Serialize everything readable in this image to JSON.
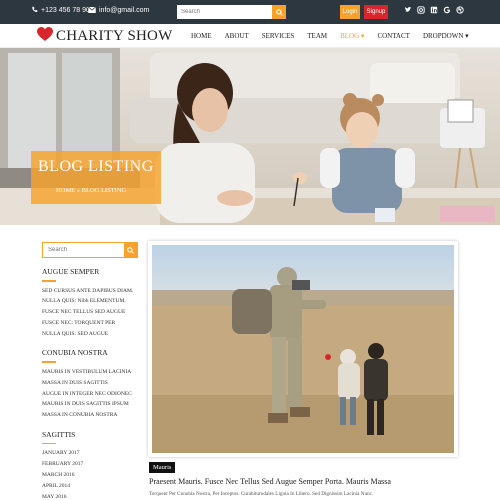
{
  "topbar": {
    "phone": "+123 456 78 90",
    "email": "info@gmail.com",
    "search_placeholder": "Search",
    "login_label": "Login",
    "signup_label": "Signup",
    "social_icons": [
      "twitter-icon",
      "instagram-icon",
      "linkedin-icon",
      "google-icon",
      "dribbble-icon"
    ],
    "bg_color": "#2d3740",
    "accent_color": "#f7a22c",
    "signup_color": "#d9262c"
  },
  "header": {
    "logo_text": "CHARITY SHOW",
    "nav": [
      {
        "label": "HOME"
      },
      {
        "label": "ABOUT"
      },
      {
        "label": "SERVICES"
      },
      {
        "label": "TEAM"
      },
      {
        "label": "BLOG ▾",
        "active": true
      },
      {
        "label": "CONTACT"
      },
      {
        "label": "DROPDOWN ▾"
      }
    ]
  },
  "hero": {
    "title": "BLOG LISTING",
    "breadcrumb": "HOME » BLOG LISTING"
  },
  "sidebar": {
    "search_placeholder": "Search",
    "sections": [
      {
        "title": "AUGUE SEMPER",
        "items": [
          "SED CURSUS ANTE DAPIBUS DIAM.",
          "NULLA QUIS: Nibh ELEMENTUM.",
          "FUSCE NEC TELLUS SED AUGUE",
          "FUSCE NEC: TORQUENT PER",
          "NULLA QUIS: SED AUGUE"
        ]
      },
      {
        "title": "CONUBIA NOSTRA",
        "items": [
          "MAURIS IN VESTIBULUM LACINIA",
          "MASSA IN DUIS SAGITTIS",
          "AUGUE IN INTEGER NEC ODIONEC",
          "MAURIS IN DUIS SAGITTIS IPSUM",
          "MASSA IN CONUBIA NOSTRA"
        ]
      },
      {
        "title": "SAGITTIS",
        "items": [
          "JANUARY 2017",
          "FEBRUARY 2017",
          "MARCH 2016",
          "APRIL 2014",
          "MAY 2016"
        ]
      }
    ]
  },
  "post": {
    "tag": "Mauris",
    "title": "Praesent Mauris. Fusce Nec Tellus Sed Augue Semper Porta. Mauris Massa",
    "excerpt": "Torquent Per Conubia Nostra, Per Inceptos. Curabiturodales Ligula In Libero. Sed Dignissim Lacinia Nunc."
  }
}
